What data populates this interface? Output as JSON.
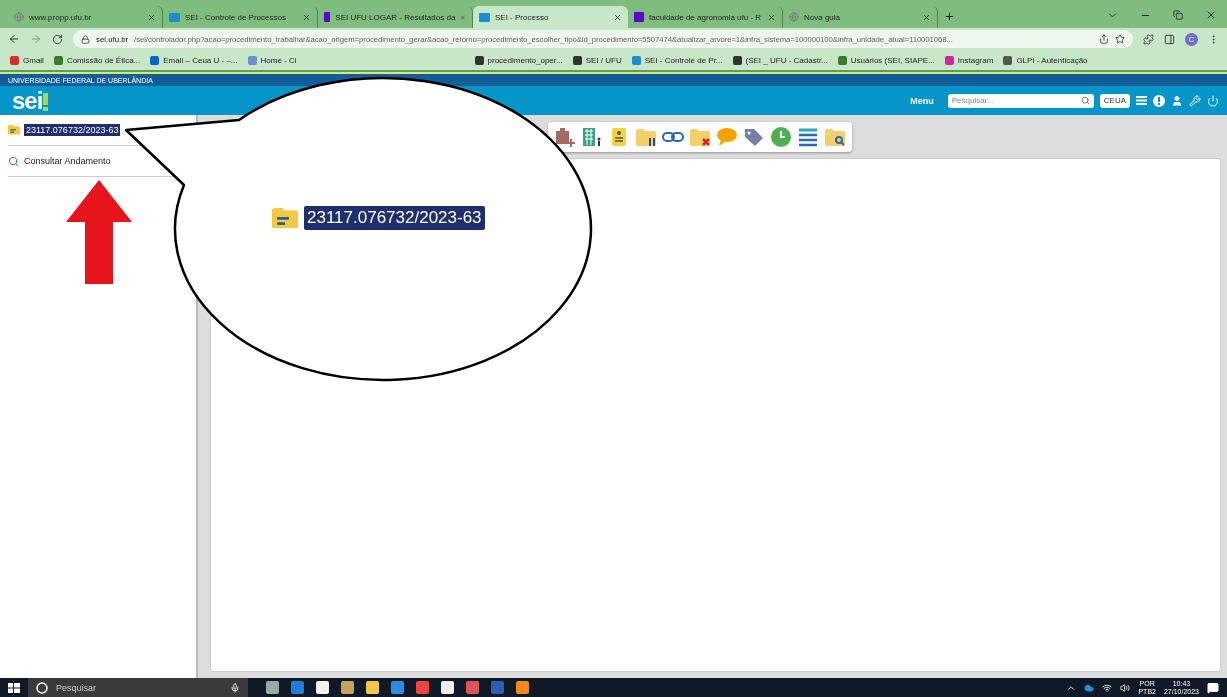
{
  "browser": {
    "tabs": [
      {
        "title": "www.propp.ufu.br",
        "kind": "globe",
        "selected": false
      },
      {
        "title": "SEI - Controle de Processos",
        "kind": "sei",
        "selected": false
      },
      {
        "title": "SEI UFU LOGAR - Resultados da",
        "kind": "yahoo",
        "selected": false
      },
      {
        "title": "SEI - Processo",
        "kind": "sei",
        "selected": true
      },
      {
        "title": "faculdade de agronomia ufu - R",
        "kind": "yahoo",
        "selected": false
      },
      {
        "title": "Nova guia",
        "kind": "globe",
        "selected": false
      }
    ],
    "address": {
      "host": "sei.ufu.br",
      "path": "/sei/controlador.php?acao=procedimento_trabalhar&acao_origem=procedimento_gerar&acao_retorno=procedimento_escolher_tipo&id_procedimento=5507474&atualizar_arvore=1&infra_sistema=100000100&infra_unidade_atual=110001068..."
    },
    "profile_initial": "C",
    "bookmarks": [
      {
        "label": "Gmail",
        "kind": "gmail"
      },
      {
        "label": "Comissão de Ética...",
        "kind": "folder"
      },
      {
        "label": "Email – Ceua U - –...",
        "kind": "outlook"
      },
      {
        "label": "Home - Ci",
        "kind": "page"
      },
      {
        "label": "procedimento_oper...",
        "kind": "globe"
      },
      {
        "label": "SEI / UFU",
        "kind": "globe"
      },
      {
        "label": "SEI - Controle de Pr...",
        "kind": "sei"
      },
      {
        "label": "(SEI _ UFU - Cadastr...",
        "kind": "globe"
      },
      {
        "label": "Usuários (SEI, SIAPE...",
        "kind": "folder"
      },
      {
        "label": "Instagram",
        "kind": "instagram"
      },
      {
        "label": "GLPI - Autenticação",
        "kind": "glpi"
      }
    ]
  },
  "sei": {
    "institution": "UNIVERSIDADE FEDERAL DE UBERLÂNDIA",
    "logo": "sei",
    "menu": "Menu",
    "search": {
      "placeholder": "Pesquisar..."
    },
    "unit": "CEUA",
    "sidebar": {
      "process": {
        "number": "23117.076732/2023-63",
        "selected": true
      },
      "items": [
        "Consultar Andamento"
      ]
    },
    "toolbar": [
      {
        "kind": "puzzle-plus"
      },
      {
        "kind": "building"
      },
      {
        "kind": "document"
      },
      {
        "kind": "folder-pause"
      },
      {
        "kind": "link"
      },
      {
        "kind": "folder-x"
      },
      {
        "kind": "comment"
      },
      {
        "kind": "tag"
      },
      {
        "kind": "clock"
      },
      {
        "kind": "list"
      },
      {
        "kind": "folder-search"
      }
    ]
  },
  "callout": {
    "text": "23117.076732/2023-63"
  },
  "taskbar": {
    "search": {
      "placeholder": "Pesquisar"
    },
    "apps": [
      {
        "kind": "task-view"
      },
      {
        "kind": "edge"
      },
      {
        "kind": "store"
      },
      {
        "kind": "paint"
      },
      {
        "kind": "files"
      },
      {
        "kind": "compass"
      },
      {
        "kind": "chrome"
      },
      {
        "kind": "mail"
      },
      {
        "kind": "chrome-profile"
      },
      {
        "kind": "word"
      },
      {
        "kind": "orange-app"
      }
    ],
    "language": "POR",
    "layout": "PTB2",
    "time": "10:43",
    "date": "27/10/2023"
  }
}
